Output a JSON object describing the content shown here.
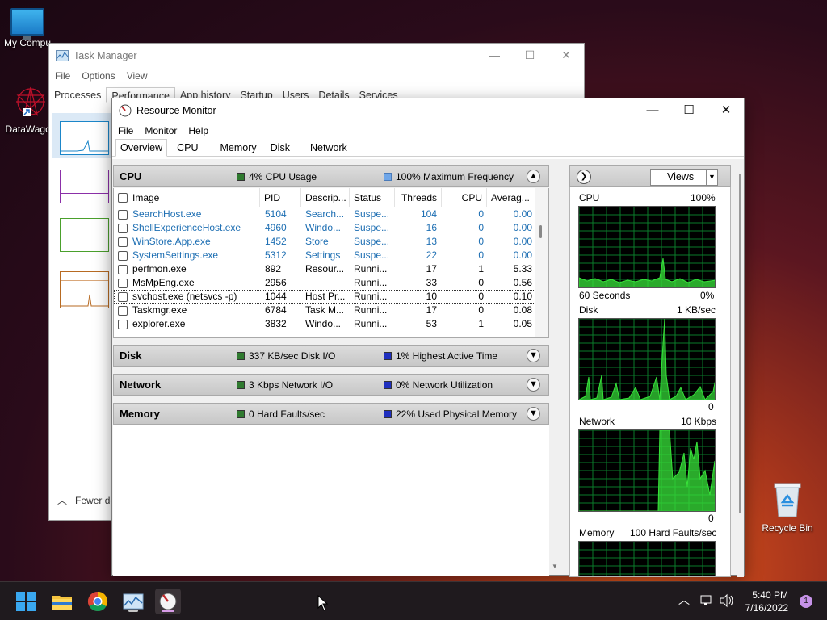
{
  "desktop": {
    "icons": [
      {
        "label": "My Compu"
      },
      {
        "label": "DataWagon"
      },
      {
        "label": "Recycle Bin"
      }
    ]
  },
  "taskmgr": {
    "title": "Task Manager",
    "menu": [
      "File",
      "Options",
      "View"
    ],
    "tabs": [
      "Processes",
      "Performance",
      "App history",
      "Startup",
      "Users",
      "Details",
      "Services"
    ],
    "fewer_details": "Fewer de"
  },
  "resmon": {
    "title": "Resource Monitor",
    "menu": [
      "File",
      "Monitor",
      "Help"
    ],
    "tabs": [
      "Overview",
      "CPU",
      "Memory",
      "Disk",
      "Network"
    ],
    "cpu": {
      "name": "CPU",
      "metric1": "4% CPU Usage",
      "metric2": "100% Maximum Frequency",
      "metric1_color": "#2f7a2f",
      "metric2_color": "#6fa6e8",
      "columns": [
        "Image",
        "PID",
        "Descrip...",
        "Status",
        "Threads",
        "CPU",
        "Averag..."
      ],
      "rows": [
        {
          "image": "SearchHost.exe",
          "pid": "5104",
          "desc": "Search...",
          "status": "Suspe...",
          "threads": "104",
          "cpu": "0",
          "avg": "0.00",
          "suspended": true
        },
        {
          "image": "ShellExperienceHost.exe",
          "pid": "4960",
          "desc": "Windo...",
          "status": "Suspe...",
          "threads": "16",
          "cpu": "0",
          "avg": "0.00",
          "suspended": true
        },
        {
          "image": "WinStore.App.exe",
          "pid": "1452",
          "desc": "Store",
          "status": "Suspe...",
          "threads": "13",
          "cpu": "0",
          "avg": "0.00",
          "suspended": true
        },
        {
          "image": "SystemSettings.exe",
          "pid": "5312",
          "desc": "Settings",
          "status": "Suspe...",
          "threads": "22",
          "cpu": "0",
          "avg": "0.00",
          "suspended": true
        },
        {
          "image": "perfmon.exe",
          "pid": "892",
          "desc": "Resour...",
          "status": "Runni...",
          "threads": "17",
          "cpu": "1",
          "avg": "5.33",
          "suspended": false
        },
        {
          "image": "MsMpEng.exe",
          "pid": "2956",
          "desc": "",
          "status": "Runni...",
          "threads": "33",
          "cpu": "0",
          "avg": "0.56",
          "suspended": false
        },
        {
          "image": "svchost.exe (netsvcs -p)",
          "pid": "1044",
          "desc": "Host Pr...",
          "status": "Runni...",
          "threads": "10",
          "cpu": "0",
          "avg": "0.10",
          "suspended": false
        },
        {
          "image": "Taskmgr.exe",
          "pid": "6784",
          "desc": "Task M...",
          "status": "Runni...",
          "threads": "17",
          "cpu": "0",
          "avg": "0.08",
          "suspended": false
        },
        {
          "image": "explorer.exe",
          "pid": "3832",
          "desc": "Windo...",
          "status": "Runni...",
          "threads": "53",
          "cpu": "1",
          "avg": "0.05",
          "suspended": false
        }
      ]
    },
    "disk": {
      "name": "Disk",
      "metric1": "337 KB/sec Disk I/O",
      "metric2": "1% Highest Active Time",
      "metric1_color": "#2f7a2f",
      "metric2_color": "#1f2fbf"
    },
    "network": {
      "name": "Network",
      "metric1": "3 Kbps Network I/O",
      "metric2": "0% Network Utilization",
      "metric1_color": "#2f7a2f",
      "metric2_color": "#1f2fbf"
    },
    "memory": {
      "name": "Memory",
      "metric1": "0 Hard Faults/sec",
      "metric2": "22% Used Physical Memory",
      "metric1_color": "#2f7a2f",
      "metric2_color": "#1f2fbf"
    },
    "side": {
      "views_label": "Views",
      "cpu_label": "CPU",
      "cpu_max": "100%",
      "cpu_time": "60 Seconds",
      "cpu_min": "0%",
      "disk_label": "Disk",
      "disk_max": "1 KB/sec",
      "disk_min": "0",
      "net_label": "Network",
      "net_max": "10 Kbps",
      "net_min": "0",
      "mem_label": "Memory",
      "mem_max": "100 Hard Faults/sec"
    }
  },
  "taskbar": {
    "time": "5:40 PM",
    "date": "7/16/2022",
    "notification_count": "1"
  },
  "colors": {
    "graph_bg": "#000000",
    "graph_grid": "#0a7a2a",
    "graph_line": "#38e33a",
    "link_blue": "#1e6fb3"
  }
}
